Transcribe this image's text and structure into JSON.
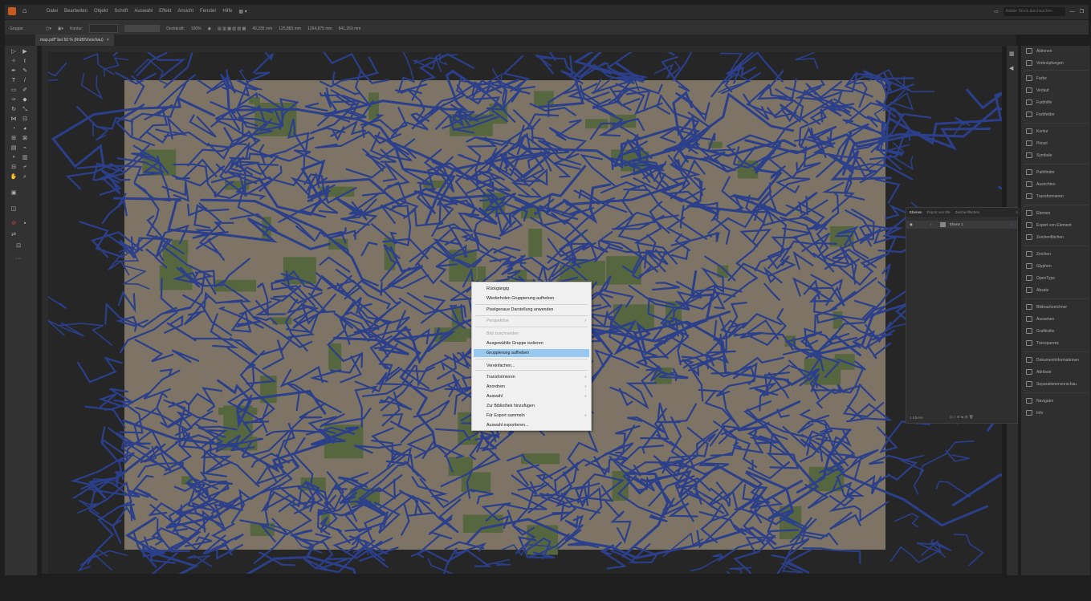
{
  "menubar": {
    "items": [
      "Datei",
      "Bearbeiten",
      "Objekt",
      "Schrift",
      "Auswahl",
      "Effekt",
      "Ansicht",
      "Fenster",
      "Hilfe"
    ],
    "search_placeholder": "Adobe Stock durchsuchen"
  },
  "controlbar": {
    "selection": "Gruppe",
    "stroke_label": "Kontur:",
    "opacity_label": "Deckkraft:",
    "opacity_value": "100%",
    "x_value": "40,235 mm",
    "y_value": "125,883 mm",
    "w_value": "1264,875 mm",
    "h_value": "841,259 mm"
  },
  "document_tab": {
    "label": "map.pdf* bei 50 % (RGB/Vorschau)",
    "close": "×"
  },
  "context_menu": {
    "items": [
      {
        "label": "Rückgängig",
        "enabled": true
      },
      {
        "label": "Wiederholen Gruppierung aufheben",
        "enabled": true
      },
      {
        "label": "Pixelgenaue Darstellung anwenden",
        "enabled": true
      },
      {
        "label": "Perspektive",
        "enabled": false,
        "submenu": true
      },
      {
        "label": "Bild zuschneiden",
        "enabled": false
      },
      {
        "label": "Ausgewählte Gruppe isolieren",
        "enabled": true
      },
      {
        "label": "Gruppierung aufheben",
        "enabled": true,
        "highlighted": true
      },
      {
        "label": "Vereinfachen...",
        "enabled": true
      },
      {
        "label": "Transformieren",
        "enabled": true,
        "submenu": true
      },
      {
        "label": "Anordnen",
        "enabled": true,
        "submenu": true
      },
      {
        "label": "Auswahl",
        "enabled": true,
        "submenu": true
      },
      {
        "label": "Zur Bibliothek hinzufügen",
        "enabled": true
      },
      {
        "label": "Für Export sammeln",
        "enabled": true,
        "submenu": true
      },
      {
        "label": "Auswahl exportieren...",
        "enabled": true
      }
    ]
  },
  "layers_panel": {
    "tabs": [
      "Ebenen",
      "Export von Ele",
      "Zeichenflächen"
    ],
    "layer_name": "Ebene 1",
    "footer": "1 Ebene"
  },
  "right_panel": {
    "items": [
      {
        "label": "Aktionen",
        "icon": "play-icon"
      },
      {
        "label": "Verknüpfungen",
        "icon": "link-icon"
      },
      {
        "label": "Farbe",
        "icon": "palette-icon"
      },
      {
        "label": "Verlauf",
        "icon": "gradient-icon"
      },
      {
        "label": "Farbhilfe",
        "icon": "color-guide-icon"
      },
      {
        "label": "Farbfelder",
        "icon": "swatches-icon"
      },
      {
        "label": "Kontur",
        "icon": "stroke-icon"
      },
      {
        "label": "Pinsel",
        "icon": "brush-icon"
      },
      {
        "label": "Symbole",
        "icon": "symbols-icon"
      },
      {
        "label": "Pathfinder",
        "icon": "pathfinder-icon"
      },
      {
        "label": "Ausrichten",
        "icon": "align-icon"
      },
      {
        "label": "Transformieren",
        "icon": "transform-icon"
      },
      {
        "label": "Ebenen",
        "icon": "layers-icon"
      },
      {
        "label": "Export von Element",
        "icon": "asset-export-icon"
      },
      {
        "label": "Zeichenflächen",
        "icon": "artboards-icon"
      },
      {
        "label": "Zeichen",
        "icon": "character-icon"
      },
      {
        "label": "Glyphen",
        "icon": "glyphs-icon"
      },
      {
        "label": "OpenType",
        "icon": "opentype-icon"
      },
      {
        "label": "Absatz",
        "icon": "paragraph-icon"
      },
      {
        "label": "Bildnachzeichner",
        "icon": "image-trace-icon"
      },
      {
        "label": "Aussehen",
        "icon": "appearance-icon"
      },
      {
        "label": "Grafikstile",
        "icon": "graphic-styles-icon"
      },
      {
        "label": "Transparenz",
        "icon": "transparency-icon"
      },
      {
        "label": "Dokumentinformationen",
        "icon": "document-info-icon"
      },
      {
        "label": "Attribute",
        "icon": "attributes-icon"
      },
      {
        "label": "Separationenvorschau",
        "icon": "separations-icon"
      },
      {
        "label": "Navigator",
        "icon": "navigator-icon"
      },
      {
        "label": "Info",
        "icon": "info-icon"
      }
    ]
  },
  "colors": {
    "map_land": "#7d7466",
    "map_park": "#56663f",
    "map_selection": "#2b3f8a",
    "menu_highlight": "#99c9f0"
  }
}
